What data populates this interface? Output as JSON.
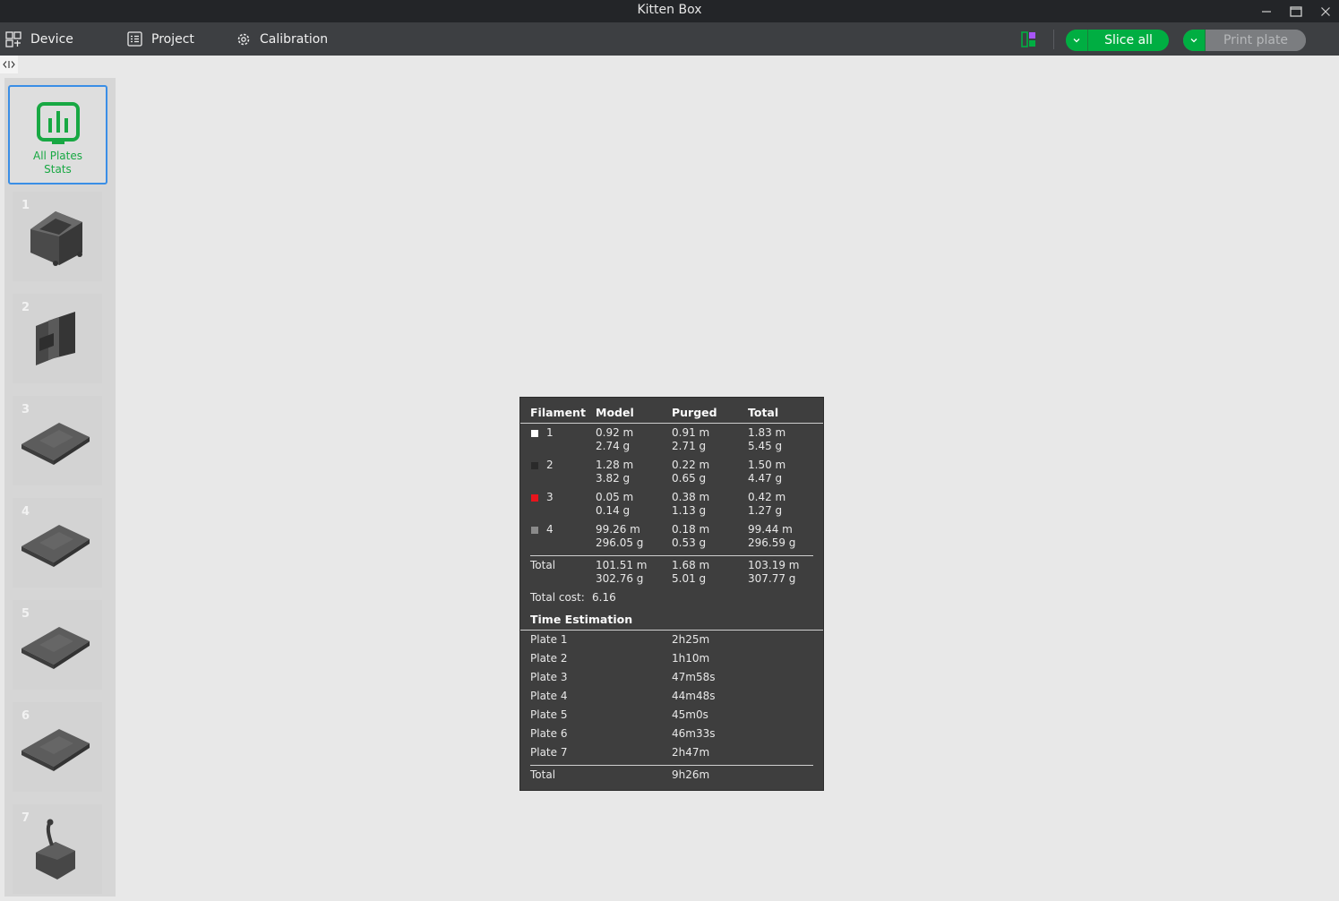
{
  "window": {
    "title": "Kitten Box"
  },
  "toolbar": {
    "device_label": "Device",
    "project_label": "Project",
    "calibration_label": "Calibration",
    "slice_all_label": "Slice all",
    "print_plate_label": "Print plate"
  },
  "sidebar": {
    "stats_label_line1": "All Plates",
    "stats_label_line2": "Stats",
    "plates": [
      {
        "num": "1"
      },
      {
        "num": "2"
      },
      {
        "num": "3"
      },
      {
        "num": "4"
      },
      {
        "num": "5"
      },
      {
        "num": "6"
      },
      {
        "num": "7"
      }
    ]
  },
  "colors": {
    "accent_green": "#00ae42",
    "selection_blue": "#3a8ee6"
  },
  "stats": {
    "headers": {
      "filament": "Filament",
      "model": "Model",
      "purged": "Purged",
      "total": "Total"
    },
    "filaments": [
      {
        "id": "1",
        "color": "#ffffff",
        "model_len": "0.92 m",
        "model_wt": "2.74 g",
        "purged_len": "0.91 m",
        "purged_wt": "2.71 g",
        "total_len": "1.83 m",
        "total_wt": "5.45 g"
      },
      {
        "id": "2",
        "color": "#2a2a2a",
        "model_len": "1.28 m",
        "model_wt": "3.82 g",
        "purged_len": "0.22 m",
        "purged_wt": "0.65 g",
        "total_len": "1.50 m",
        "total_wt": "4.47 g"
      },
      {
        "id": "3",
        "color": "#e8141c",
        "model_len": "0.05 m",
        "model_wt": "0.14 g",
        "purged_len": "0.38 m",
        "purged_wt": "1.13 g",
        "total_len": "0.42 m",
        "total_wt": "1.27 g"
      },
      {
        "id": "4",
        "color": "#8a8a8a",
        "model_len": "99.26 m",
        "model_wt": "296.05 g",
        "purged_len": "0.18 m",
        "purged_wt": "0.53 g",
        "total_len": "99.44 m",
        "total_wt": "296.59 g"
      }
    ],
    "total_row": {
      "label": "Total",
      "model_len": "101.51 m",
      "model_wt": "302.76 g",
      "purged_len": "1.68 m",
      "purged_wt": "5.01 g",
      "total_len": "103.19 m",
      "total_wt": "307.77 g"
    },
    "total_cost_label": "Total cost:",
    "total_cost_value": "6.16",
    "time_header": "Time Estimation",
    "plate_times": [
      {
        "label": "Plate 1",
        "time": "2h25m"
      },
      {
        "label": "Plate 2",
        "time": "1h10m"
      },
      {
        "label": "Plate 3",
        "time": "47m58s"
      },
      {
        "label": "Plate 4",
        "time": "44m48s"
      },
      {
        "label": "Plate 5",
        "time": "45m0s"
      },
      {
        "label": "Plate 6",
        "time": "46m33s"
      },
      {
        "label": "Plate 7",
        "time": "2h47m"
      }
    ],
    "time_total_label": "Total",
    "time_total_value": "9h26m"
  }
}
